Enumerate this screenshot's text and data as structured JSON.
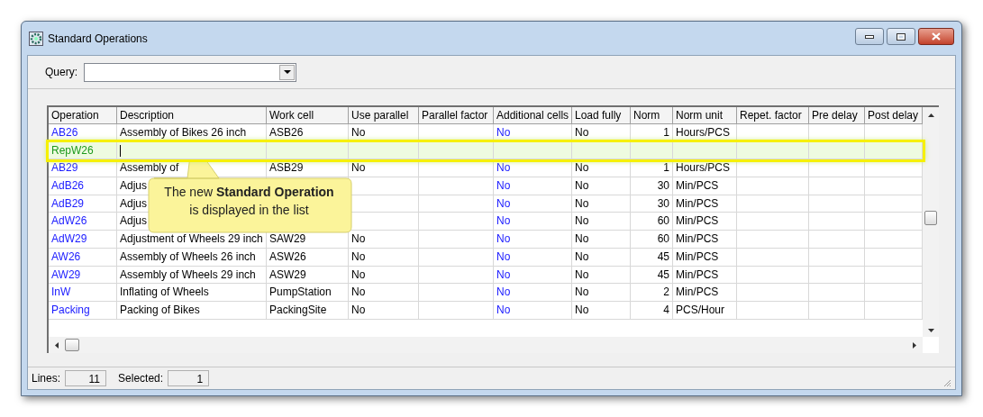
{
  "window": {
    "title": "Standard Operations"
  },
  "query": {
    "label": "Query:"
  },
  "table": {
    "columns": [
      "Operation",
      "Description",
      "Work cell",
      "Use parallel",
      "Parallel factor",
      "Additional cells",
      "Load fully",
      "Norm",
      "Norm unit",
      "Repet. factor",
      "Pre delay",
      "Post delay"
    ],
    "rows": [
      {
        "operation": "AB26",
        "description": "Assembly of Bikes 26 inch",
        "work_cell": "ASB26",
        "use_parallel": "No",
        "additional_cells": "No",
        "load_fully": "No",
        "norm": "1",
        "norm_unit": "Hours/PCS",
        "is_new": false
      },
      {
        "operation": "RepW26",
        "is_new": true
      },
      {
        "operation": "AB29",
        "description": "Assembly of",
        "work_cell": "ASB29",
        "use_parallel": "No",
        "additional_cells": "No",
        "load_fully": "No",
        "norm": "1",
        "norm_unit": "Hours/PCS",
        "is_new": false
      },
      {
        "operation": "AdB26",
        "description": "Adjus",
        "additional_cells": "No",
        "load_fully": "No",
        "norm": "30",
        "norm_unit": "Min/PCS",
        "is_new": false
      },
      {
        "operation": "AdB29",
        "description": "Adjus",
        "additional_cells": "No",
        "load_fully": "No",
        "norm": "30",
        "norm_unit": "Min/PCS",
        "is_new": false
      },
      {
        "operation": "AdW26",
        "description": "Adjus",
        "additional_cells": "No",
        "load_fully": "No",
        "norm": "60",
        "norm_unit": "Min/PCS",
        "is_new": false
      },
      {
        "operation": "AdW29",
        "description": "Adjustment of Wheels 29 inch",
        "work_cell": "SAW29",
        "use_parallel": "No",
        "additional_cells": "No",
        "load_fully": "No",
        "norm": "60",
        "norm_unit": "Min/PCS",
        "is_new": false
      },
      {
        "operation": "AW26",
        "description": "Assembly of Wheels 26 inch",
        "work_cell": "ASW26",
        "use_parallel": "No",
        "additional_cells": "No",
        "load_fully": "No",
        "norm": "45",
        "norm_unit": "Min/PCS",
        "is_new": false
      },
      {
        "operation": "AW29",
        "description": "Assembly of Wheels 29 inch",
        "work_cell": "ASW29",
        "use_parallel": "No",
        "additional_cells": "No",
        "load_fully": "No",
        "norm": "45",
        "norm_unit": "Min/PCS",
        "is_new": false
      },
      {
        "operation": "InW",
        "description": "Inflating of Wheels",
        "work_cell": "PumpStation",
        "use_parallel": "No",
        "additional_cells": "No",
        "load_fully": "No",
        "norm": "2",
        "norm_unit": "Min/PCS",
        "is_new": false
      },
      {
        "operation": "Packing",
        "description": "Packing of Bikes",
        "work_cell": "PackingSite",
        "use_parallel": "No",
        "additional_cells": "No",
        "load_fully": "No",
        "norm": "4",
        "norm_unit": "PCS/Hour",
        "is_new": false
      }
    ]
  },
  "callout": {
    "text": "The new **Standard Operation** is displayed in the list"
  },
  "status_bar": {
    "lines_label": "Lines:",
    "lines": "11",
    "selected_label": "Selected:",
    "selected": "1"
  }
}
